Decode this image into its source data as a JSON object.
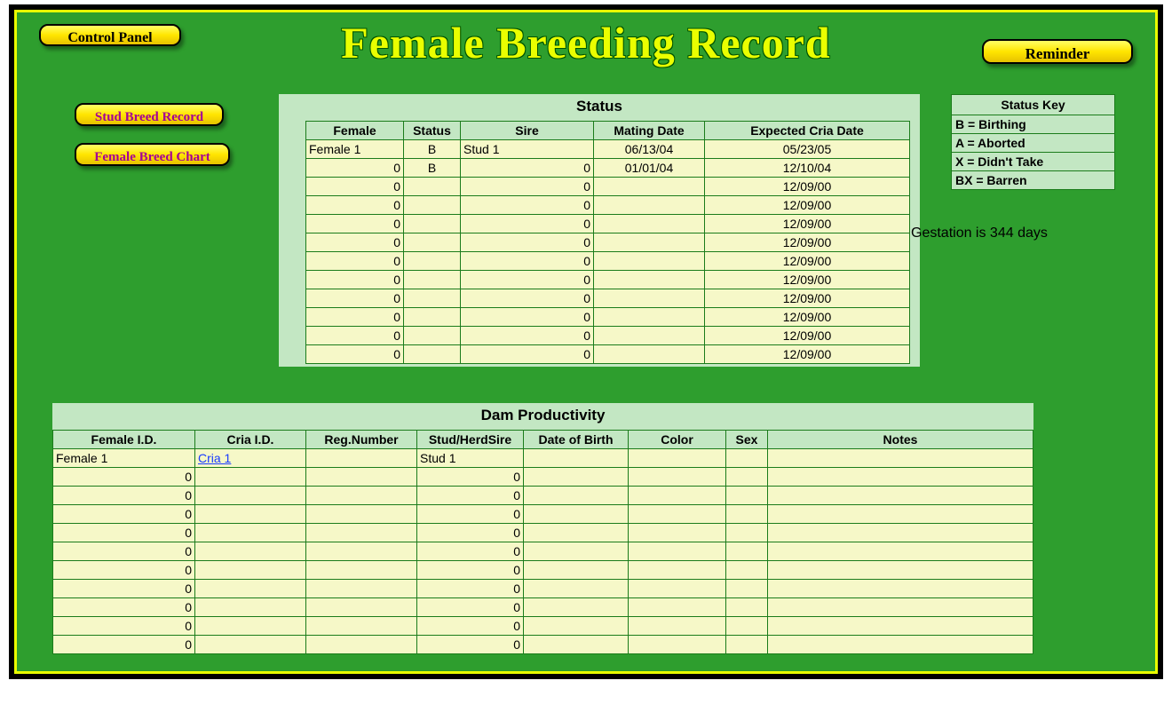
{
  "title": "Female Breeding Record",
  "buttons": {
    "control_panel": "Control Panel",
    "reminder": "Reminder",
    "stud_breed": "Stud Breed Record",
    "female_chart": "Female Breed Chart"
  },
  "status": {
    "title": "Status",
    "headers": [
      "Female",
      "Status",
      "Sire",
      "Mating Date",
      "Expected Cria Date"
    ],
    "rows": [
      {
        "female": "Female 1",
        "status": "B",
        "sire": "Stud 1",
        "mating": "06/13/04",
        "cria": "05/23/05"
      },
      {
        "female": "0",
        "status": "B",
        "sire": "0",
        "mating": "01/01/04",
        "cria": "12/10/04"
      },
      {
        "female": "0",
        "status": "",
        "sire": "0",
        "mating": "",
        "cria": "12/09/00"
      },
      {
        "female": "0",
        "status": "",
        "sire": "0",
        "mating": "",
        "cria": "12/09/00"
      },
      {
        "female": "0",
        "status": "",
        "sire": "0",
        "mating": "",
        "cria": "12/09/00"
      },
      {
        "female": "0",
        "status": "",
        "sire": "0",
        "mating": "",
        "cria": "12/09/00"
      },
      {
        "female": "0",
        "status": "",
        "sire": "0",
        "mating": "",
        "cria": "12/09/00"
      },
      {
        "female": "0",
        "status": "",
        "sire": "0",
        "mating": "",
        "cria": "12/09/00"
      },
      {
        "female": "0",
        "status": "",
        "sire": "0",
        "mating": "",
        "cria": "12/09/00"
      },
      {
        "female": "0",
        "status": "",
        "sire": "0",
        "mating": "",
        "cria": "12/09/00"
      },
      {
        "female": "0",
        "status": "",
        "sire": "0",
        "mating": "",
        "cria": "12/09/00"
      },
      {
        "female": "0",
        "status": "",
        "sire": "0",
        "mating": "",
        "cria": "12/09/00"
      }
    ]
  },
  "key": {
    "title": "Status Key",
    "items": [
      "B = Birthing",
      "A = Aborted",
      "X = Didn't Take",
      "BX = Barren"
    ]
  },
  "gestation": "Gestation is 344 days",
  "dam": {
    "title": "Dam Productivity",
    "headers": [
      "Female I.D.",
      "Cria I.D.",
      "Reg.Number",
      "Stud/HerdSire",
      "Date of Birth",
      "Color",
      "Sex",
      "Notes"
    ],
    "rows": [
      {
        "fid": "Female 1",
        "cid": "Cria 1",
        "cid_link": true,
        "reg": "",
        "stud": "Stud 1",
        "dob": "",
        "color": "",
        "sex": "",
        "notes": ""
      },
      {
        "fid": "0",
        "cid": "",
        "reg": "",
        "stud": "0",
        "dob": "",
        "color": "",
        "sex": "",
        "notes": ""
      },
      {
        "fid": "0",
        "cid": "",
        "reg": "",
        "stud": "0",
        "dob": "",
        "color": "",
        "sex": "",
        "notes": ""
      },
      {
        "fid": "0",
        "cid": "",
        "reg": "",
        "stud": "0",
        "dob": "",
        "color": "",
        "sex": "",
        "notes": ""
      },
      {
        "fid": "0",
        "cid": "",
        "reg": "",
        "stud": "0",
        "dob": "",
        "color": "",
        "sex": "",
        "notes": ""
      },
      {
        "fid": "0",
        "cid": "",
        "reg": "",
        "stud": "0",
        "dob": "",
        "color": "",
        "sex": "",
        "notes": ""
      },
      {
        "fid": "0",
        "cid": "",
        "reg": "",
        "stud": "0",
        "dob": "",
        "color": "",
        "sex": "",
        "notes": ""
      },
      {
        "fid": "0",
        "cid": "",
        "reg": "",
        "stud": "0",
        "dob": "",
        "color": "",
        "sex": "",
        "notes": ""
      },
      {
        "fid": "0",
        "cid": "",
        "reg": "",
        "stud": "0",
        "dob": "",
        "color": "",
        "sex": "",
        "notes": ""
      },
      {
        "fid": "0",
        "cid": "",
        "reg": "",
        "stud": "0",
        "dob": "",
        "color": "",
        "sex": "",
        "notes": ""
      },
      {
        "fid": "0",
        "cid": "",
        "reg": "",
        "stud": "0",
        "dob": "",
        "color": "",
        "sex": "",
        "notes": ""
      }
    ]
  }
}
